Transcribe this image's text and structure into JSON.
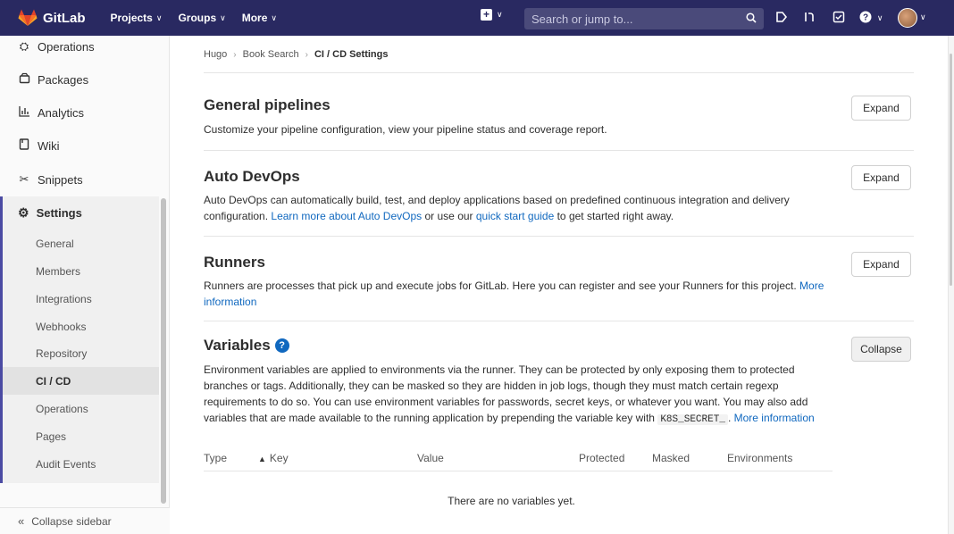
{
  "topnav": {
    "brand": "GitLab",
    "menus": [
      {
        "label": "Projects"
      },
      {
        "label": "Groups"
      },
      {
        "label": "More"
      }
    ],
    "search_placeholder": "Search or jump to...",
    "colors": {
      "bar": "#292961",
      "accent": "#4b4ba3",
      "link": "#1068bf"
    }
  },
  "sidebar": {
    "items": [
      {
        "label": "Operations",
        "icon": "operations-icon"
      },
      {
        "label": "Packages",
        "icon": "package-icon"
      },
      {
        "label": "Analytics",
        "icon": "chart-icon"
      },
      {
        "label": "Wiki",
        "icon": "book-icon"
      },
      {
        "label": "Snippets",
        "icon": "scissors-icon"
      }
    ],
    "settings": {
      "label": "Settings",
      "sub_items": [
        {
          "label": "General"
        },
        {
          "label": "Members"
        },
        {
          "label": "Integrations"
        },
        {
          "label": "Webhooks"
        },
        {
          "label": "Repository"
        },
        {
          "label": "CI / CD",
          "active": true
        },
        {
          "label": "Operations"
        },
        {
          "label": "Pages"
        },
        {
          "label": "Audit Events"
        }
      ]
    },
    "collapse_label": "Collapse sidebar"
  },
  "breadcrumb": {
    "items": [
      "Hugo",
      "Book Search"
    ],
    "current": "CI / CD Settings"
  },
  "sections": {
    "general": {
      "title": "General pipelines",
      "desc": "Customize your pipeline configuration, view your pipeline status and coverage report.",
      "button": "Expand"
    },
    "autodevops": {
      "title": "Auto DevOps",
      "desc_pre": "Auto DevOps can automatically build, test, and deploy applications based on predefined continuous integration and delivery configuration. ",
      "link1": "Learn more about Auto DevOps",
      "desc_mid": " or use our ",
      "link2": "quick start guide",
      "desc_post": " to get started right away.",
      "button": "Expand"
    },
    "runners": {
      "title": "Runners",
      "desc_pre": "Runners are processes that pick up and execute jobs for GitLab. Here you can register and see your Runners for this project. ",
      "link": "More information",
      "button": "Expand"
    },
    "variables": {
      "title": "Variables",
      "help_glyph": "?",
      "desc_pre": "Environment variables are applied to environments via the runner. They can be protected by only exposing them to protected branches or tags. Additionally, they can be masked so they are hidden in job logs, though they must match certain regexp requirements to do so. You can use environment variables for passwords, secret keys, or whatever you want. You may also add variables that are made available to the running application by prepending the variable key with ",
      "code": "K8S_SECRET_",
      "desc_post": ". ",
      "link": "More information",
      "button": "Collapse",
      "table": {
        "headers": [
          "Type",
          "Key",
          "Value",
          "Protected",
          "Masked",
          "Environments"
        ],
        "empty": "There are no variables yet."
      }
    }
  }
}
